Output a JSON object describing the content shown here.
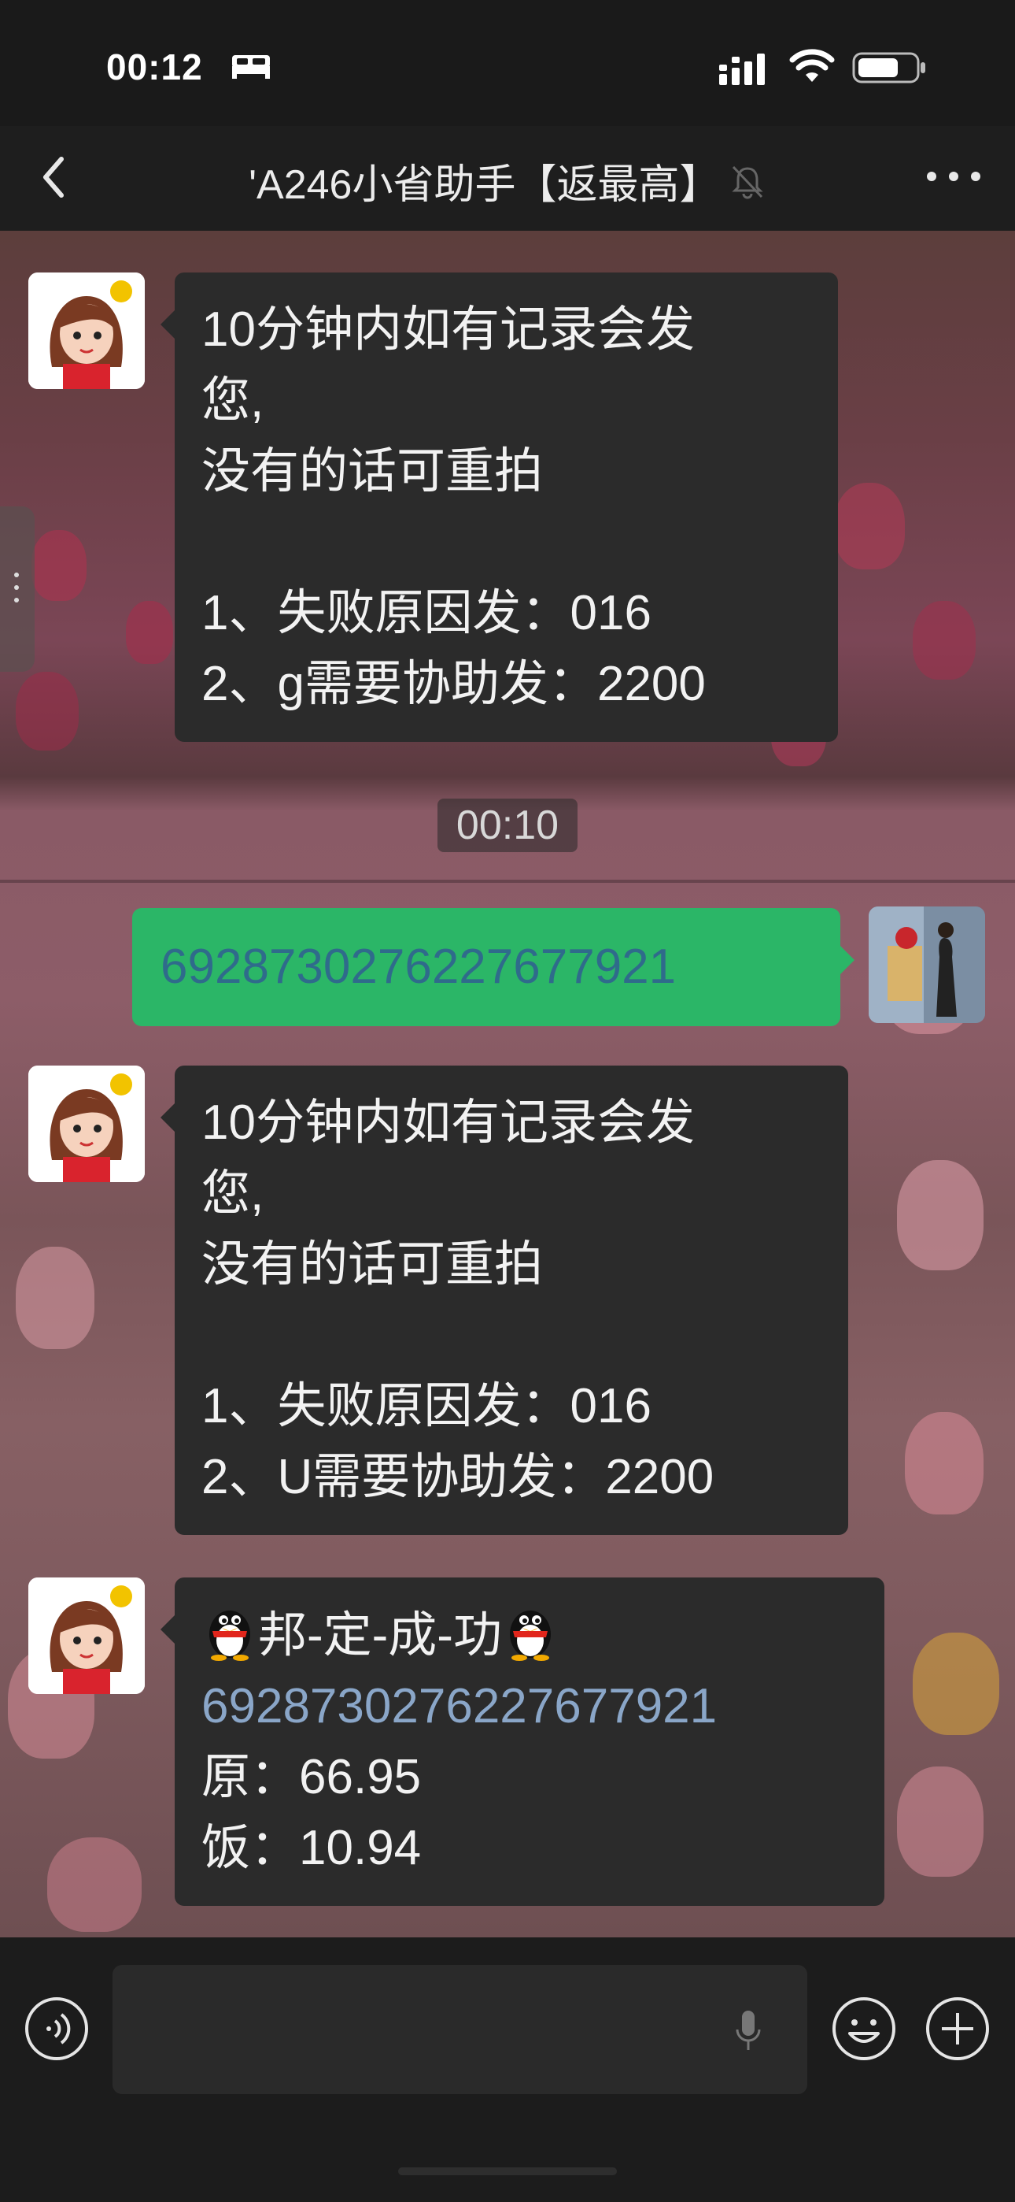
{
  "status_bar": {
    "time": "00:12"
  },
  "nav": {
    "title": "'A246小省助手【返最高】"
  },
  "messages": {
    "m1": {
      "lines": [
        "10分钟内如有记录会发",
        "您,",
        "没有的话可重拍",
        "",
        "1、失败原因发：016",
        "2、g需要协助发：2200"
      ]
    },
    "timestamp": "00:10",
    "m2": {
      "text": "6928730276227677921"
    },
    "m3": {
      "lines": [
        "10分钟内如有记录会发",
        "您,",
        "没有的话可重拍",
        "",
        "1、失败原因发：016",
        "2、U需要协助发：2200"
      ]
    },
    "m4": {
      "title": "邦-定-成-功",
      "link": "6928730276227677921",
      "price_original": "原：66.95",
      "price_rebate": "饭：10.94"
    }
  },
  "colors": {
    "green_bubble": "#2bb667",
    "dark_bubble": "#2b2b2b",
    "link": "#8aa6c8"
  }
}
